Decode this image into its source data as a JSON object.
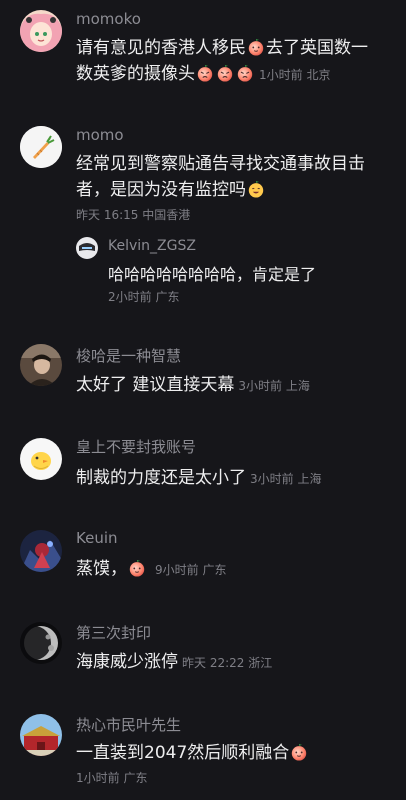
{
  "comments": [
    {
      "username": "momoko",
      "line1": "请有意见的香港人移民",
      "line1b": "去了英国数一",
      "line2": "数英爹的摄像头",
      "meta": "1小时前 北京",
      "avatar_icon": "anime-girl-avatar-icon"
    },
    {
      "username": "momo",
      "line1": "经常见到警察贴通告寻找交通事故目击",
      "line2": "者，是因为没有监控吗",
      "meta": "昨天 16:15 中国香港",
      "avatar_icon": "carrot-avatar-icon",
      "reply": {
        "username": "Kelvin_ZGSZ",
        "text": "哈哈哈哈哈哈哈哈，肯定是了",
        "meta": "2小时前 广东"
      }
    },
    {
      "username": "梭哈是一种智慧",
      "text": "太好了 建议直接天幕",
      "meta": "3小时前 上海"
    },
    {
      "username": "皇上不要封我账号",
      "text": "制裁的力度还是太小了",
      "meta": "3小时前 上海"
    },
    {
      "username": "Keuin",
      "text": "蒸馍，",
      "meta": "9小时前 广东"
    },
    {
      "username": "第三次封印",
      "text": "海康威少涨停",
      "meta": "昨天 22:22 浙江"
    },
    {
      "username": "热心市民叶先生",
      "text": "一直装到2047然后顺利融合",
      "meta": "1小时前 广东"
    }
  ],
  "colors": {
    "background": "#16161a",
    "username": "#8c8c93",
    "text": "#eeeeef",
    "meta": "#7f7f86"
  }
}
